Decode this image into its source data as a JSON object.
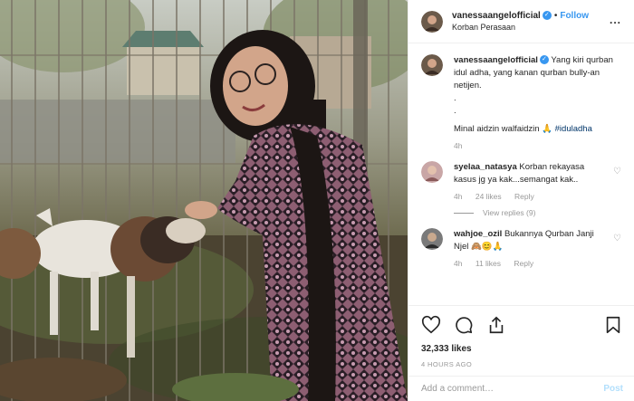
{
  "header": {
    "username": "vanessaangelofficial",
    "verified_glyph": "✓",
    "separator": "•",
    "follow_label": "Follow",
    "location": "Korban Perasaan",
    "more_label": "..."
  },
  "caption": {
    "username": "vanessaangelofficial",
    "text_line1": "Yang kiri qurban idul adha, yang kanan qurban bully-an netijen.",
    "dot1": ".",
    "dot2": ".",
    "text_line2": "Minal aidzin walfaidzin 🙏",
    "hashtag": "#iduladha",
    "time": "4h"
  },
  "comments": [
    {
      "username": "syelaa_natasya",
      "text": "Korban rekayasa kasus jg ya kak...semangat kak..",
      "time": "4h",
      "likes": "24 likes",
      "reply": "Reply",
      "view_replies": "View replies (9)"
    },
    {
      "username": "wahjoe_ozil",
      "text": "Bukannya Qurban Janji Njel 🙈😊🙏",
      "time": "4h",
      "likes": "11 likes",
      "reply": "Reply"
    }
  ],
  "actions": {
    "likes_count": "32,333 likes",
    "posted": "4 HOURS AGO"
  },
  "composer": {
    "placeholder": "Add a comment…",
    "post_label": "Post"
  },
  "icons": [
    "heart-icon",
    "comment-icon",
    "share-icon",
    "bookmark-icon",
    "verified-icon",
    "more-icon"
  ],
  "colors": {
    "accent": "#3897f0",
    "post_disabled": "#b2dffc",
    "muted": "#999999",
    "hashtag": "#003569"
  }
}
